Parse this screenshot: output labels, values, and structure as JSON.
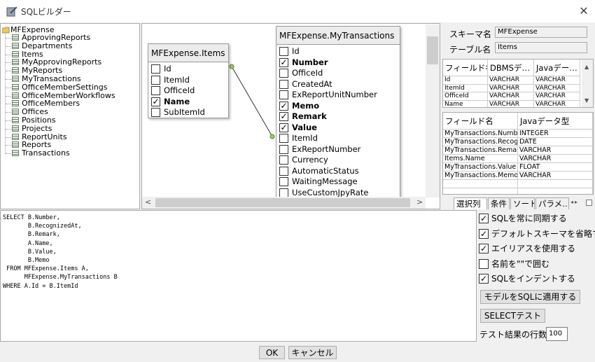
{
  "window": {
    "title": "SQLビルダー",
    "close": "✕"
  },
  "tree": {
    "root": "MFExpense",
    "items": [
      "ApprovingReports",
      "Departments",
      "Items",
      "MyApprovingReports",
      "MyReports",
      "MyTransactions",
      "OfficeMemberSettings",
      "OfficeMemberWorkflows",
      "OfficeMembers",
      "Offices",
      "Positions",
      "Projects",
      "ReportUnits",
      "Reports",
      "Transactions"
    ]
  },
  "entities": {
    "items": {
      "title": "MFExpense.Items",
      "fields": [
        {
          "name": "Id",
          "checked": false
        },
        {
          "name": "ItemId",
          "checked": false
        },
        {
          "name": "OfficeId",
          "checked": false
        },
        {
          "name": "Name",
          "checked": true
        },
        {
          "name": "SubItemId",
          "checked": false
        }
      ]
    },
    "transactions": {
      "title": "MFExpense.MyTransactions",
      "fields": [
        {
          "name": "Id",
          "checked": false
        },
        {
          "name": "Number",
          "checked": true
        },
        {
          "name": "OfficeId",
          "checked": false
        },
        {
          "name": "CreatedAt",
          "checked": false
        },
        {
          "name": "ExReportUnitNumber",
          "checked": false
        },
        {
          "name": "Memo",
          "checked": true
        },
        {
          "name": "Remark",
          "checked": true
        },
        {
          "name": "Value",
          "checked": true
        },
        {
          "name": "ItemId",
          "checked": false
        },
        {
          "name": "ExReportNumber",
          "checked": false
        },
        {
          "name": "Currency",
          "checked": false
        },
        {
          "name": "AutomaticStatus",
          "checked": false
        },
        {
          "name": "WaitingMessage",
          "checked": false
        },
        {
          "name": "UseCustomJpyRate",
          "checked": false
        }
      ]
    }
  },
  "scroll": {
    "left": "<",
    "right": ">"
  },
  "properties": {
    "schema_label": "スキーマ名",
    "schema_value": "MFExpense",
    "table_label": "テーブル名",
    "table_value": "Items",
    "field_grid": {
      "headers": [
        "フィールド名",
        "DBMSデ…",
        "Javaデー…"
      ],
      "rows": [
        [
          "Id",
          "VARCHAR",
          "VARCHAR"
        ],
        [
          "ItemId",
          "VARCHAR",
          "VARCHAR"
        ],
        [
          "OfficeId",
          "VARCHAR",
          "VARCHAR"
        ],
        [
          "Name",
          "VARCHAR",
          "VARCHAR"
        ]
      ]
    },
    "select_grid": {
      "headers": [
        "フィールド名",
        "Javaデータ型"
      ],
      "rows": [
        [
          "MyTransactions.Number",
          "INTEGER"
        ],
        [
          "MyTransactions.Recog…",
          "DATE"
        ],
        [
          "MyTransactions.Remark",
          "VARCHAR"
        ],
        [
          "Items.Name",
          "VARCHAR"
        ],
        [
          "MyTransactions.Value",
          "FLOAT"
        ],
        [
          "MyTransactions.Memo",
          "VARCHAR"
        ]
      ]
    },
    "tabs": [
      "選択列",
      "条件",
      "ソート",
      "パラメ…"
    ]
  },
  "sql": {
    "lines": [
      "SELECT B.Number,",
      "       B.RecognizedAt,",
      "       B.Remark,",
      "       A.Name,",
      "       B.Value,",
      "       B.Memo",
      " FROM MFExpense.Items A,",
      "      MFExpense.MyTransactions B",
      "WHERE A.Id = B.ItemId"
    ]
  },
  "options": [
    {
      "label": "SQLを常に同期する",
      "checked": true
    },
    {
      "label": "デフォルトスキーマを省略する",
      "checked": true
    },
    {
      "label": "エイリアスを使用する",
      "checked": true
    },
    {
      "label": "名前を\"\"で囲む",
      "checked": false
    },
    {
      "label": "SQLをインデントする",
      "checked": true
    }
  ],
  "buttons": {
    "apply": "モデルをSQLに適用する",
    "select_test": "SELECTテスト",
    "ok": "OK",
    "cancel": "キャンセル"
  },
  "result_rows": {
    "label": "テスト結果の行数",
    "value": "100"
  }
}
